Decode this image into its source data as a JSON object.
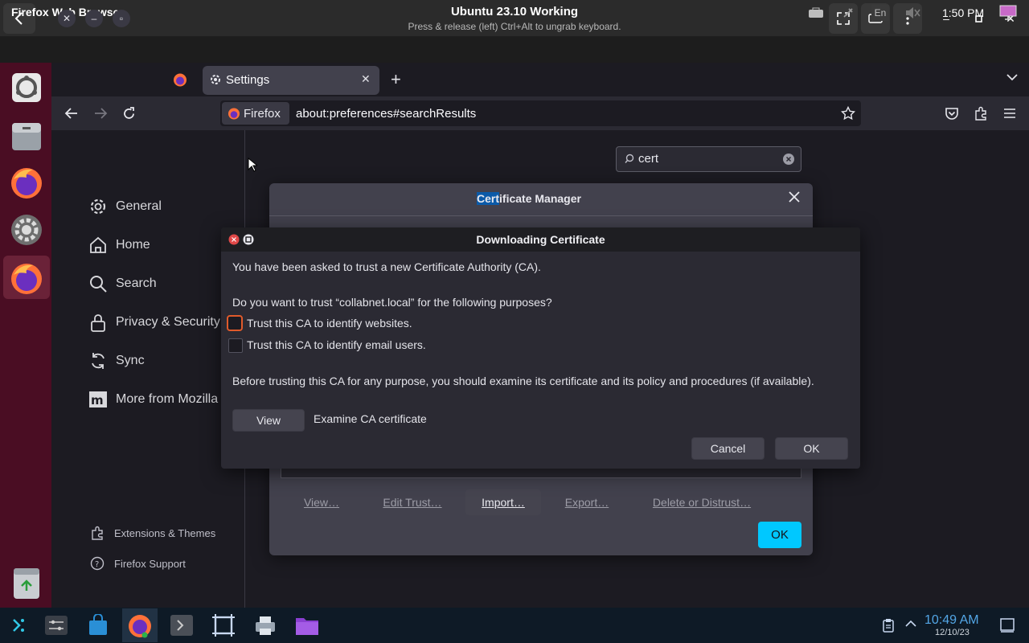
{
  "vm": {
    "title": "Ubuntu 23.10 Working",
    "subtitle": "Press & release (left) Ctrl+Alt to ungrab keyboard."
  },
  "panel": {
    "app_name": "Firefox Web Browser",
    "lang": "En",
    "clock": "1:50 PM"
  },
  "browser": {
    "tab_title": "Settings",
    "url_chip": "Firefox",
    "url": "about:preferences#searchResults"
  },
  "settings": {
    "search_value": "cert",
    "sidebar": [
      {
        "label": "General",
        "icon": "gear-icon"
      },
      {
        "label": "Home",
        "icon": "home-icon"
      },
      {
        "label": "Search",
        "icon": "search-icon"
      },
      {
        "label": "Privacy & Security",
        "icon": "lock-icon"
      },
      {
        "label": "Sync",
        "icon": "sync-icon"
      },
      {
        "label": "More from Mozilla",
        "icon": "mozilla-icon"
      }
    ],
    "footer": [
      {
        "label": "Extensions & Themes",
        "icon": "puzzle-icon"
      },
      {
        "label": "Firefox Support",
        "icon": "help-icon"
      }
    ]
  },
  "cert_manager": {
    "title_highlight": "Cert",
    "title_rest": "ificate Manager",
    "buttons": [
      "View…",
      "Edit Trust…",
      "Import…",
      "Export…",
      "Delete or Distrust…"
    ],
    "ok": "OK"
  },
  "dialog": {
    "title": "Downloading Certificate",
    "line1": "You have been asked to trust a new Certificate Authority (CA).",
    "question": "Do you want to trust “collabnet.local” for the following purposes?",
    "check_websites": "Trust this CA to identify websites.",
    "check_email": "Trust this CA to identify email users.",
    "advice": "Before trusting this CA for any purpose, you should examine its certificate and its policy and procedures (if available).",
    "view_button": "View",
    "view_label": "Examine CA certificate",
    "cancel": "Cancel",
    "ok": "OK"
  },
  "taskbar": {
    "time": "10:49 AM",
    "date": "12/10/23"
  },
  "colors": {
    "accent": "#00c8ff",
    "dock": "#4a0d23",
    "focus_ring": "#e05a2b"
  }
}
